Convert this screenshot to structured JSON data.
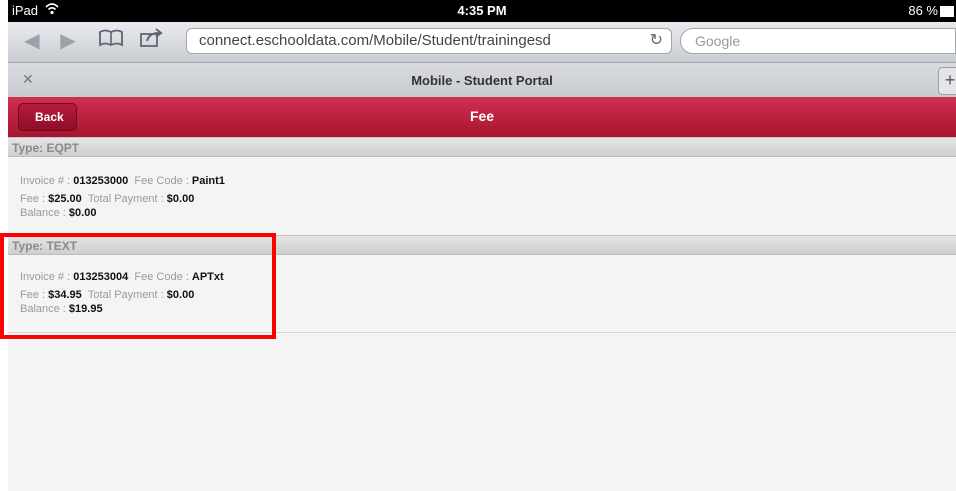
{
  "status_bar": {
    "device": "iPad",
    "time": "4:35 PM",
    "battery": "86 %"
  },
  "browser": {
    "url": "connect.eschooldata.com/Mobile/Student/trainingesd",
    "search_placeholder": "Google",
    "tab_title": "Mobile - Student Portal"
  },
  "header": {
    "back_label": "Back",
    "title": "Fee"
  },
  "fees": [
    {
      "type_label": "Type: EQPT",
      "invoice_label": "Invoice # : ",
      "invoice_value": "013253000",
      "fee_code_label": "Fee Code : ",
      "fee_code_value": "Paint1",
      "fee_label": "Fee : ",
      "fee_value": "$25.00",
      "total_payment_label": "Total Payment : ",
      "total_payment_value": "$0.00",
      "balance_label": "Balance : ",
      "balance_value": "$0.00"
    },
    {
      "type_label": "Type: TEXT",
      "invoice_label": "Invoice # : ",
      "invoice_value": "013253004",
      "fee_code_label": "Fee Code : ",
      "fee_code_value": "APTxt",
      "fee_label": "Fee : ",
      "fee_value": "$34.95",
      "total_payment_label": "Total Payment : ",
      "total_payment_value": "$0.00",
      "balance_label": "Balance : ",
      "balance_value": "$19.95"
    }
  ],
  "colors": {
    "header_red": "#b81d3b",
    "highlight": "#ff0000"
  }
}
